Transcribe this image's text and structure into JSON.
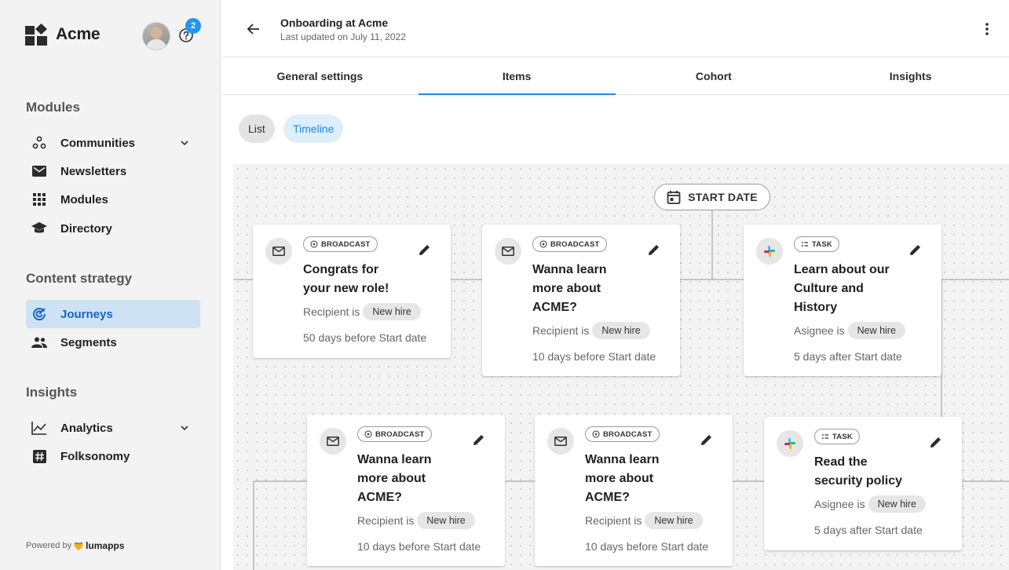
{
  "app": {
    "name": "Acme",
    "notification_count": "2",
    "powered_by_prefix": "Powered by",
    "powered_by_brand": "lumapps"
  },
  "sidebar": {
    "sections": [
      {
        "title": "Modules",
        "items": [
          {
            "label": "Communities",
            "icon": "communities-icon",
            "expandable": true
          },
          {
            "label": "Newsletters",
            "icon": "envelope-icon"
          },
          {
            "label": "Modules",
            "icon": "grid-icon"
          },
          {
            "label": "Directory",
            "icon": "graduation-cap-icon"
          }
        ]
      },
      {
        "title": "Content strategy",
        "items": [
          {
            "label": "Journeys",
            "icon": "journeys-icon",
            "active": true
          },
          {
            "label": "Segments",
            "icon": "people-icon"
          }
        ]
      },
      {
        "title": "Insights",
        "items": [
          {
            "label": "Analytics",
            "icon": "chart-line-icon",
            "expandable": true
          },
          {
            "label": "Folksonomy",
            "icon": "hashtag-icon"
          }
        ]
      }
    ]
  },
  "header": {
    "title": "Onboarding at Acme",
    "subtitle": "Last updated on July 11, 2022"
  },
  "tabs": [
    {
      "label": "General settings"
    },
    {
      "label": "Items",
      "active": true
    },
    {
      "label": "Cohort"
    },
    {
      "label": "Insights"
    }
  ],
  "view_toggle": {
    "list": "List",
    "timeline": "Timeline",
    "active": "Timeline"
  },
  "timeline": {
    "start_label": "START DATE",
    "cards": [
      {
        "type": "BROADCAST",
        "title_lines": [
          "Congrats for",
          "your new role!"
        ],
        "recipient_label": "Recipient is",
        "recipient": "New hire",
        "when": "50 days before Start date"
      },
      {
        "type": "BROADCAST",
        "title_lines": [
          "Wanna learn",
          "more about",
          "ACME?"
        ],
        "recipient_label": "Recipient is",
        "recipient": "New hire",
        "when": "10 days before Start date"
      },
      {
        "type": "TASK",
        "title_lines": [
          "Learn about our",
          "Culture and",
          "History"
        ],
        "recipient_label": "Asignee is",
        "recipient": "New hire",
        "when": "5 days after Start date"
      },
      {
        "type": "BROADCAST",
        "title_lines": [
          "Wanna learn",
          "more about",
          "ACME?"
        ],
        "recipient_label": "Recipient is",
        "recipient": "New hire",
        "when": "10 days before Start date"
      },
      {
        "type": "BROADCAST",
        "title_lines": [
          "Wanna learn",
          "more about",
          "ACME?"
        ],
        "recipient_label": "Recipient is",
        "recipient": "New hire",
        "when": "10 days before Start date"
      },
      {
        "type": "TASK",
        "title_lines": [
          "Read the",
          "security policy"
        ],
        "recipient_label": "Asignee is",
        "recipient": "New hire",
        "when": "5 days after Start date"
      }
    ]
  },
  "colors": {
    "accent": "#1e88e5",
    "active_nav_bg": "#cfe2f3",
    "badge": "#2196f3",
    "sidebar_bg": "#f3f3f3"
  }
}
